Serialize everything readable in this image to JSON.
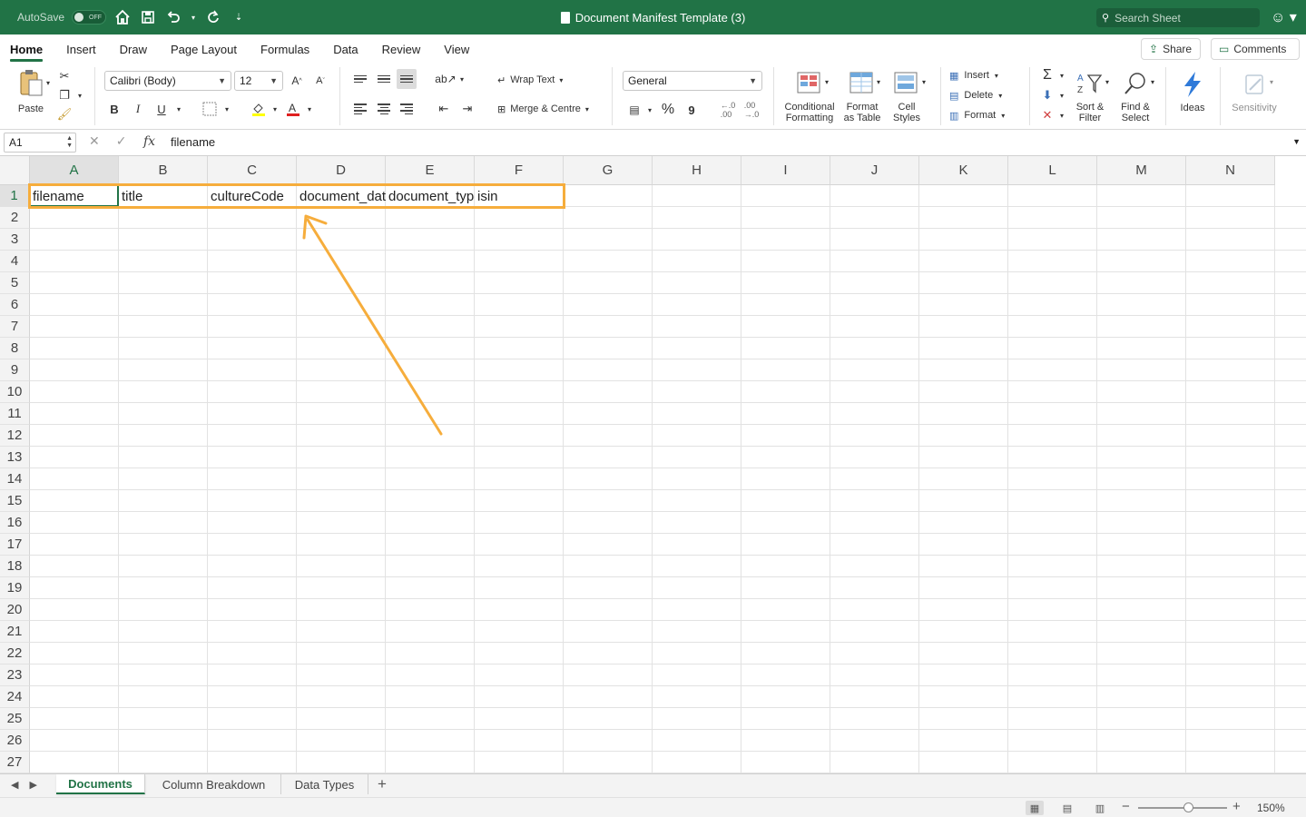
{
  "titlebar": {
    "autosave_label": "AutoSave",
    "autosave_state": "OFF",
    "doc_title": "Document Manifest Template (3)",
    "search_placeholder": "Search Sheet"
  },
  "menu_tabs": [
    "Home",
    "Insert",
    "Draw",
    "Page Layout",
    "Formulas",
    "Data",
    "Review",
    "View"
  ],
  "active_tab": "Home",
  "share_label": "Share",
  "comments_label": "Comments",
  "ribbon": {
    "paste_label": "Paste",
    "font_name": "Calibri (Body)",
    "font_size": "12",
    "wrap_text": "Wrap Text",
    "merge_centre": "Merge & Centre",
    "number_format": "General",
    "conditional_formatting": [
      "Conditional",
      "Formatting"
    ],
    "format_as_table": [
      "Format",
      "as Table"
    ],
    "cell_styles": [
      "Cell",
      "Styles"
    ],
    "insert": "Insert",
    "delete": "Delete",
    "format": "Format",
    "sort_filter": [
      "Sort &",
      "Filter"
    ],
    "find_select": [
      "Find &",
      "Select"
    ],
    "ideas": "Ideas",
    "sensitivity": "Sensitivity",
    "bold": "B",
    "italic": "I",
    "underline": "U",
    "percent": "%",
    "comma": "9"
  },
  "formula_bar": {
    "name_box": "A1",
    "fx": "fx",
    "content": "filename"
  },
  "columns": [
    "A",
    "B",
    "C",
    "D",
    "E",
    "F",
    "G",
    "H",
    "I",
    "J",
    "K",
    "L",
    "M",
    "N"
  ],
  "rows": [
    "1",
    "2",
    "3",
    "4",
    "5",
    "6",
    "7",
    "8",
    "9",
    "10",
    "11",
    "12",
    "13",
    "14",
    "15",
    "16",
    "17",
    "18",
    "19",
    "20",
    "21",
    "22",
    "23",
    "24",
    "25",
    "26",
    "27"
  ],
  "row1_cells": [
    "filename",
    "title",
    "cultureCode",
    "document_date",
    "document_type",
    "isin"
  ],
  "sheets": [
    "Documents",
    "Column Breakdown",
    "Data Types"
  ],
  "active_sheet": "Documents",
  "zoom_level": "150%",
  "annotation_color": "#f6ad3c",
  "accent_color": "#217346"
}
